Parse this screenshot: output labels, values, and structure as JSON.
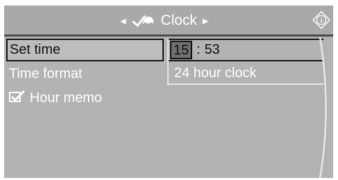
{
  "header": {
    "title": "Clock",
    "left_arrow_icon": "triangle-left-icon",
    "right_arrow_icon": "triangle-right-icon",
    "car_icon": "car-wrench-icon",
    "info_icon": "info-icon"
  },
  "menu": {
    "items": [
      {
        "label": "Set time",
        "selected": true
      },
      {
        "label": "Time format",
        "selected": false
      },
      {
        "label": "Hour memo",
        "checked": true,
        "icon": "checkbox-checked-icon"
      }
    ]
  },
  "values": {
    "time_hour": "15",
    "time_separator": ":",
    "time_minute": "53",
    "time_format": "24 hour clock"
  },
  "colors": {
    "panel_bg": "#b3b3b3",
    "header_bg": "#a9a9a9",
    "text_light": "#ffffff",
    "text_dark": "#111111",
    "highlight_bg": "#6f6f6f"
  }
}
